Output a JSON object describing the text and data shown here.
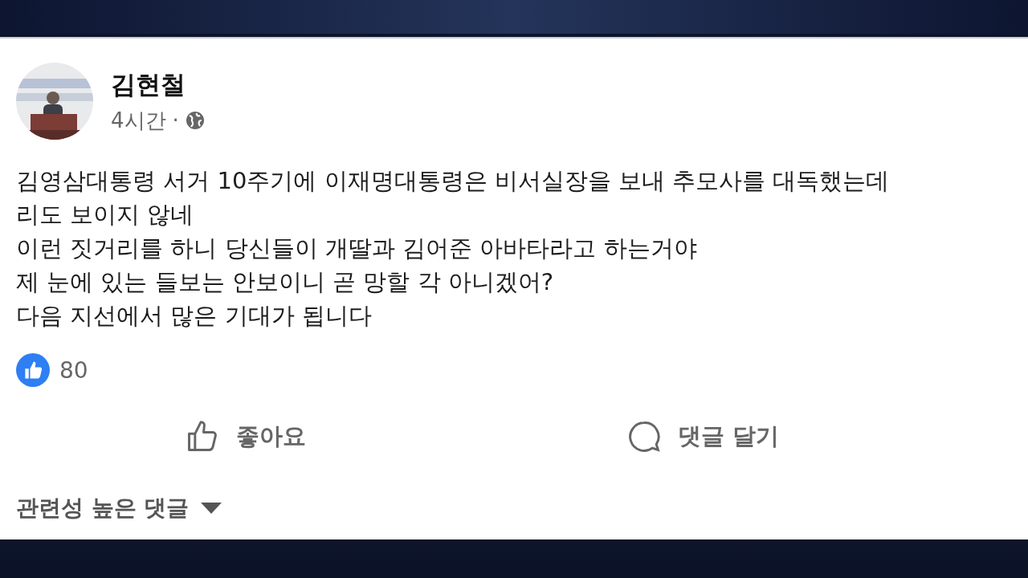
{
  "post": {
    "author": "김현철",
    "time": "4시간",
    "separator": "·",
    "lines": [
      "김영삼대통령 서거 10주기에 이재명대통령은 비서실장을 보내 추모사를 대독했는데",
      "리도 보이지 않네",
      "이런 짓거리를 하니 당신들이 개딸과 김어준 아바타라고 하는거야",
      "제 눈에 있는 들보는 안보이니 곧 망할 각 아니겠어?",
      "다음 지선에서 많은 기대가 됩니다"
    ],
    "reaction_count": "80",
    "actions": [
      {
        "kind": "like",
        "label": "좋아요"
      },
      {
        "kind": "comment",
        "label": "댓글 달기"
      }
    ],
    "comment_sort": "관련성 높은 댓글"
  }
}
